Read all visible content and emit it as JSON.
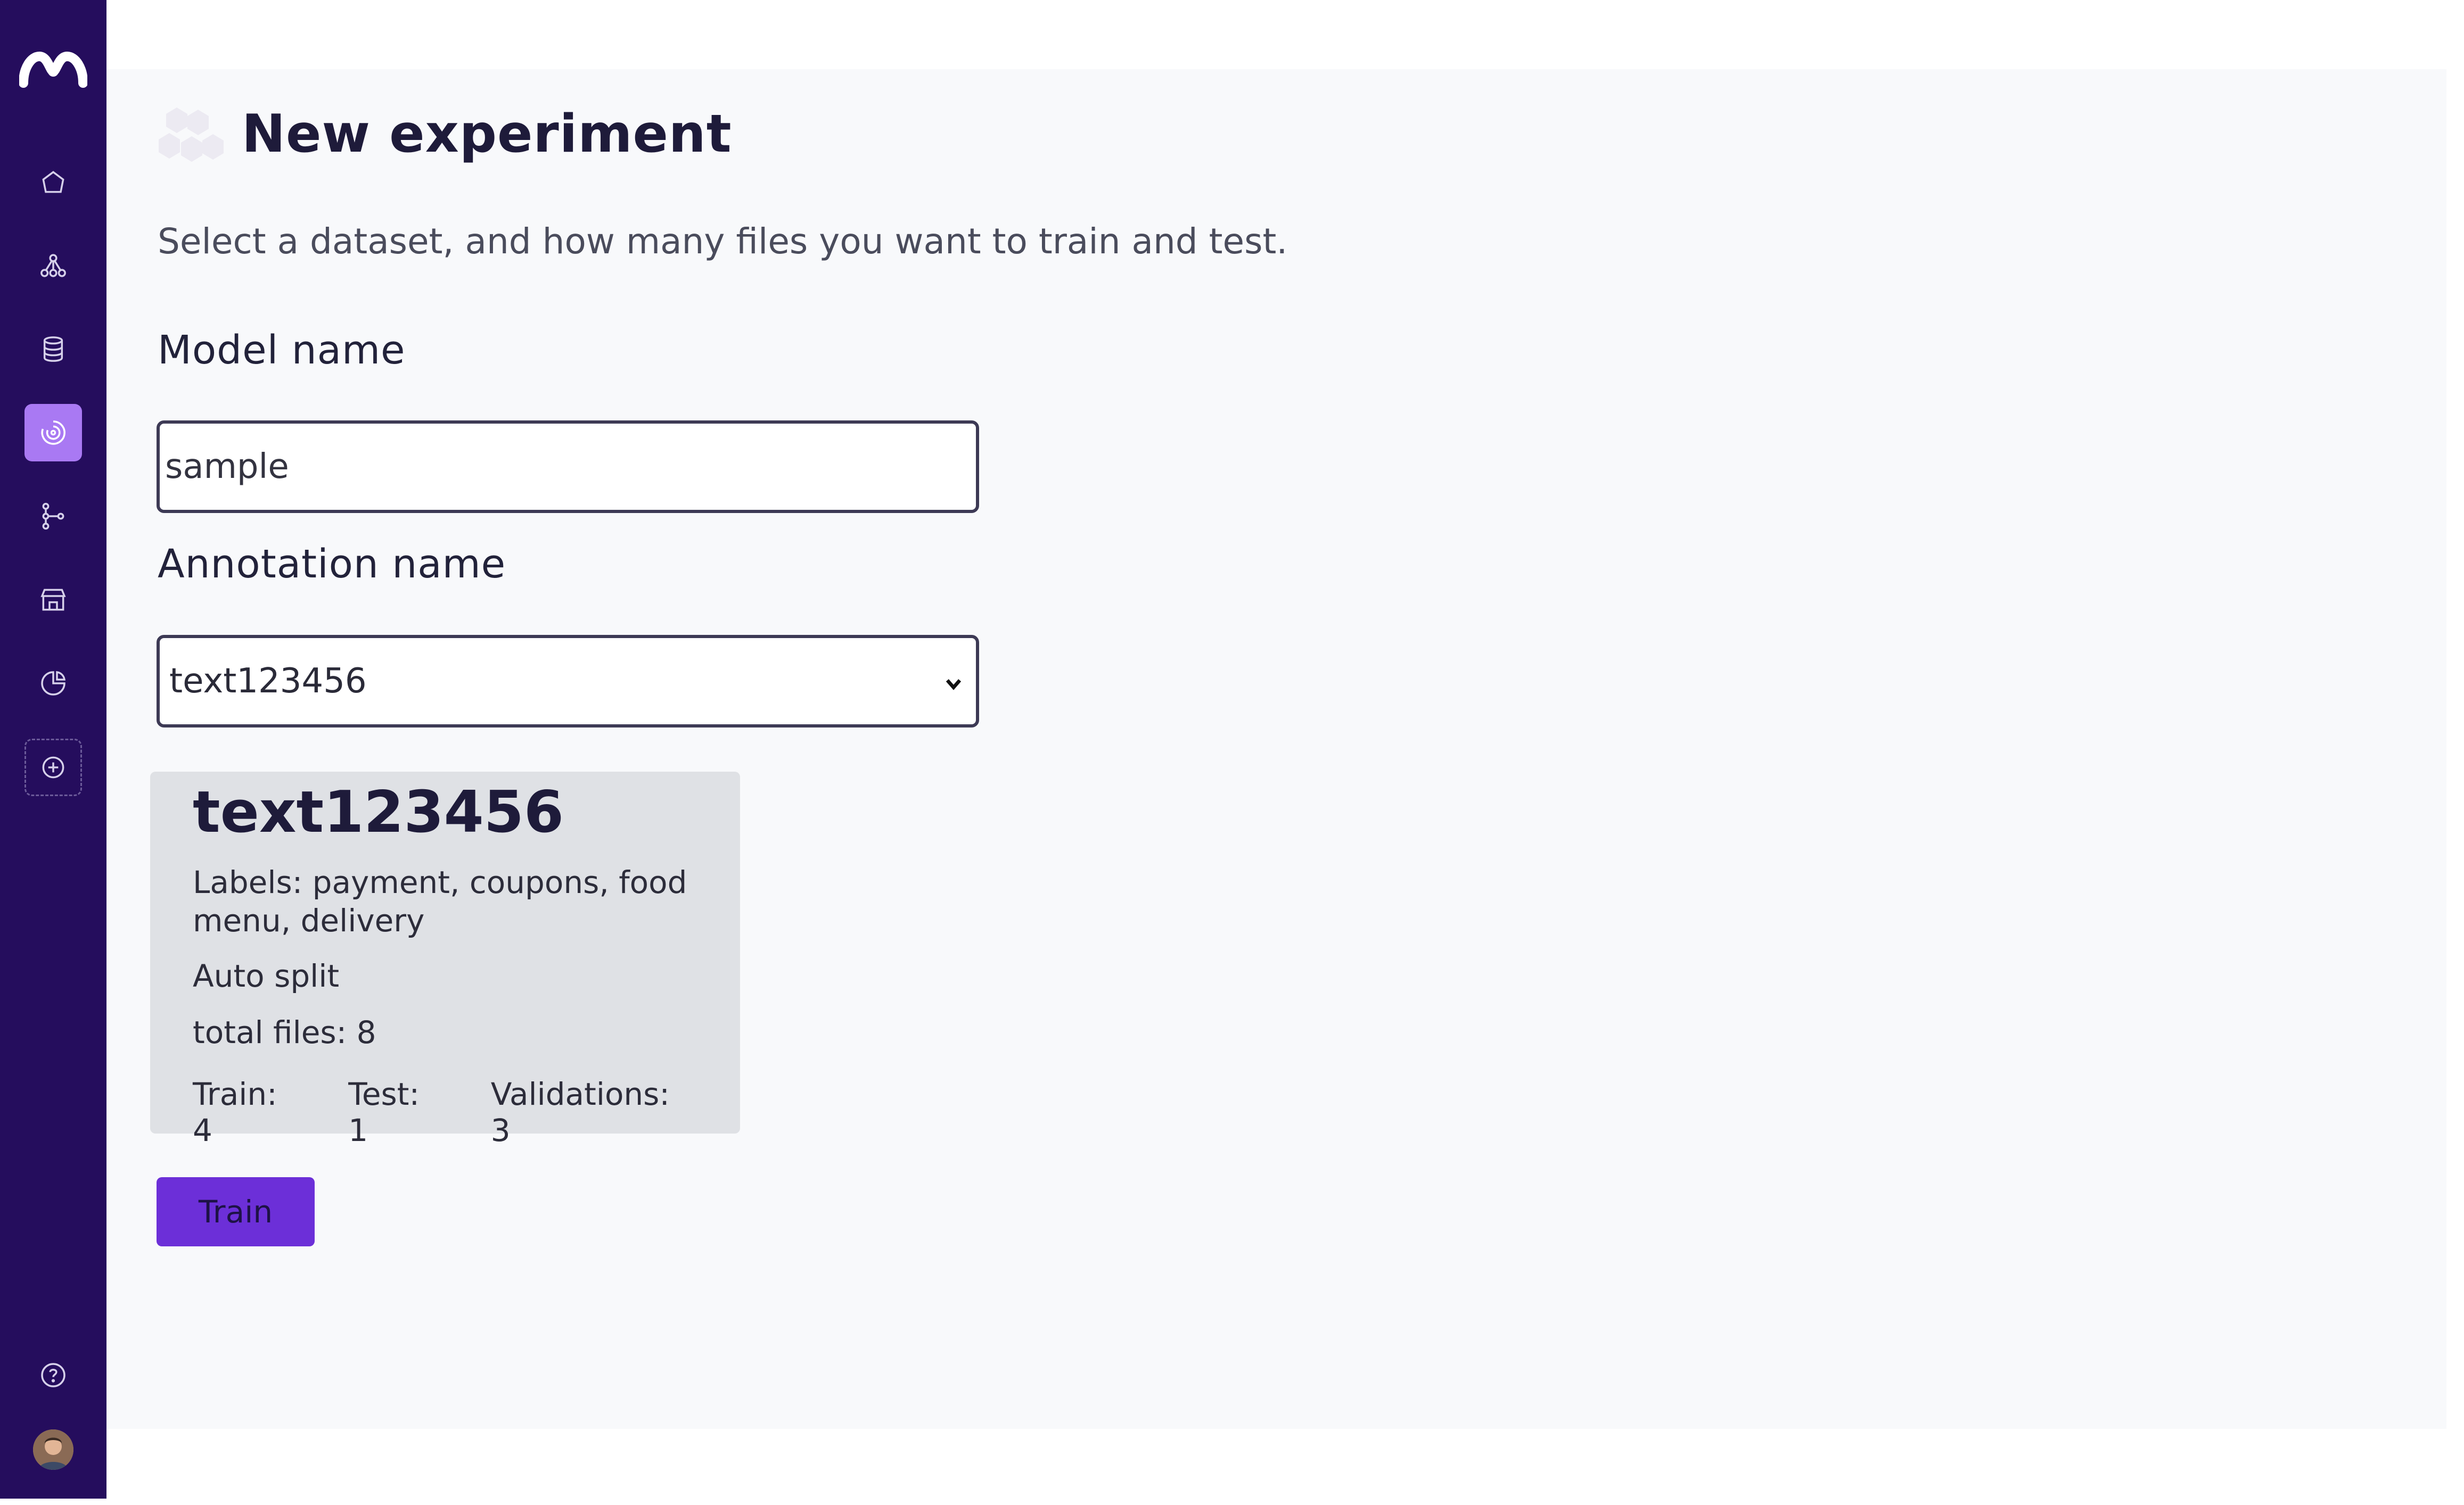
{
  "sidebar": {
    "items": [
      {
        "name": "home",
        "icon": "home-icon"
      },
      {
        "name": "models",
        "icon": "network-icon"
      },
      {
        "name": "datasets",
        "icon": "database-icon"
      },
      {
        "name": "experiments",
        "icon": "target-icon",
        "active": true
      },
      {
        "name": "pipelines",
        "icon": "branch-icon"
      },
      {
        "name": "marketplace",
        "icon": "store-icon"
      },
      {
        "name": "reports",
        "icon": "pie-chart-icon"
      },
      {
        "name": "add",
        "icon": "plus-circle-icon"
      }
    ],
    "help_icon": "help-icon",
    "active_color": "#a979f3",
    "background": "#250d5d"
  },
  "page": {
    "title": "New experiment",
    "subtitle": "Select a dataset, and how many files you want to train and test."
  },
  "form": {
    "model_name_label": "Model name",
    "model_name_value": "sample",
    "annotation_label": "Annotation name",
    "annotation_value": "text123456"
  },
  "card": {
    "title": "text123456",
    "labels": "Labels: payment, coupons, food menu, delivery",
    "split": "Auto split",
    "total": "total files: 8",
    "train": "Train: 4",
    "test": "Test: 1",
    "validations": "Validations: 3"
  },
  "actions": {
    "train_label": "Train",
    "accent": "#6c2fd8"
  }
}
